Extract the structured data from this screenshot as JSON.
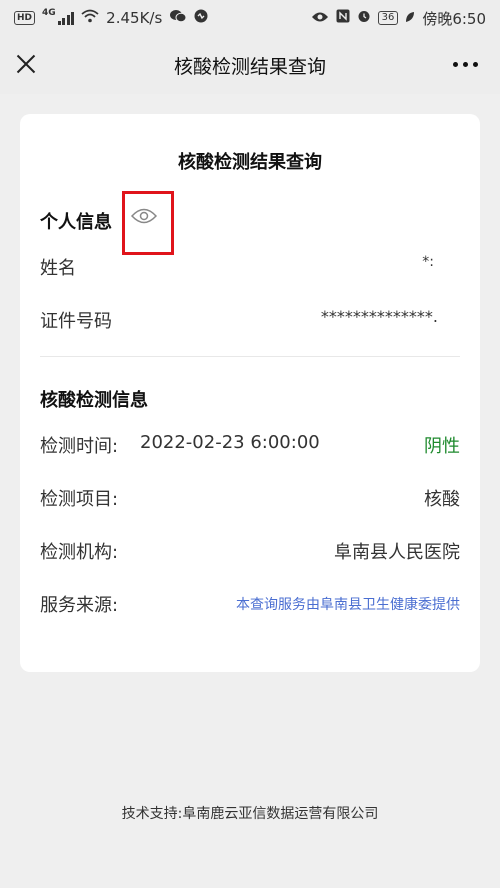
{
  "status_bar": {
    "network_badge": "HD",
    "network_type": "4G",
    "speed": "2.45K/s",
    "battery": "36",
    "time": "傍晚6:50"
  },
  "nav": {
    "title": "核酸检测结果查询"
  },
  "card": {
    "title": "核酸检测结果查询",
    "personal": {
      "heading": "个人信息",
      "name_label": "姓名",
      "name_value": "*:",
      "id_label": "证件号码",
      "id_value": "**************."
    },
    "test": {
      "heading": "核酸检测信息",
      "time_label": "检测时间:",
      "time_value": "2022-02-23 6:00:00",
      "result": "阴性",
      "item_label": "检测项目:",
      "item_value": "核酸",
      "org_label": "检测机构:",
      "org_value": "阜南县人民医院",
      "source_label": "服务来源:",
      "source_value": "本查询服务由阜南县卫生健康委提供"
    }
  },
  "footer": {
    "text": "技术支持:阜南鹿云亚信数据运营有限公司"
  },
  "colors": {
    "result_green": "#1f8a2e",
    "link_blue": "#4a6ed1",
    "highlight_red": "#e0141b"
  }
}
